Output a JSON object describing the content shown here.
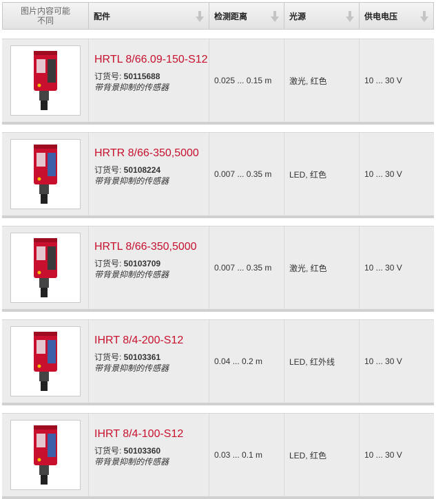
{
  "header": {
    "image_col": "图片内容可能不同",
    "part": "配件",
    "range": "检测距离",
    "light": "光源",
    "voltage": "供电电压"
  },
  "order_label": "订货号: ",
  "rows": [
    {
      "name": "HRTL 8/66.09-150-S12",
      "order_no": "50115688",
      "desc": "带背景抑制的传感器",
      "range": "0.025 ... 0.15 m",
      "light": "激光, 红色",
      "voltage": "10 ... 30 V",
      "lens": "#3a3a3a"
    },
    {
      "name": "HRTR 8/66-350,5000",
      "order_no": "50108224",
      "desc": "带背景抑制的传感器",
      "range": "0.007 ... 0.35 m",
      "light": "LED, 红色",
      "voltage": "10 ... 30 V",
      "lens": "#3c5fa8"
    },
    {
      "name": "HRTL 8/66-350,5000",
      "order_no": "50103709",
      "desc": "带背景抑制的传感器",
      "range": "0.007 ... 0.35 m",
      "light": "激光, 红色",
      "voltage": "10 ... 30 V",
      "lens": "#3a3a3a"
    },
    {
      "name": "IHRT 8/4-200-S12",
      "order_no": "50103361",
      "desc": "带背景抑制的传感器",
      "range": "0.04 ... 0.2 m",
      "light": "LED, 红外线",
      "voltage": "10 ... 30 V",
      "lens": "#3c5fa8"
    },
    {
      "name": "IHRT 8/4-100-S12",
      "order_no": "50103360",
      "desc": "带背景抑制的传感器",
      "range": "0.03 ... 0.1 m",
      "light": "LED, 红色",
      "voltage": "10 ... 30 V",
      "lens": "#3c5fa8"
    }
  ],
  "colors": {
    "accent": "#c8102e",
    "row_bg": "#ececec"
  }
}
